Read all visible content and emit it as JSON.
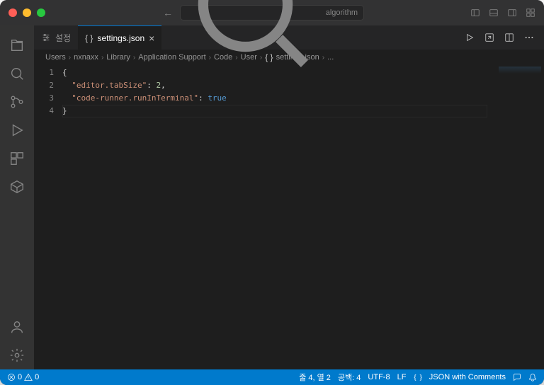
{
  "titlebar": {
    "search_placeholder": "algorithm"
  },
  "tabs": {
    "settings_label": "설정",
    "file_label": "settings.json"
  },
  "breadcrumb": {
    "parts": [
      "Users",
      "nxnaxx",
      "Library",
      "Application Support",
      "Code",
      "User"
    ],
    "file": "settings.json",
    "trail": "..."
  },
  "editor": {
    "line_numbers": [
      "1",
      "2",
      "3",
      "4"
    ],
    "lines": {
      "l1_open": "{",
      "l2_key": "\"editor.tabSize\"",
      "l2_colon": ": ",
      "l2_val": "2",
      "l2_comma": ",",
      "l3_key": "\"code-runner.runInTerminal\"",
      "l3_colon": ": ",
      "l3_val": "true",
      "l4_close": "}"
    }
  },
  "status": {
    "errors": "0",
    "warnings": "0",
    "cursor": "줄 4, 열 2",
    "spaces": "공백: 4",
    "encoding": "UTF-8",
    "eol": "LF",
    "language": "JSON with Comments"
  }
}
